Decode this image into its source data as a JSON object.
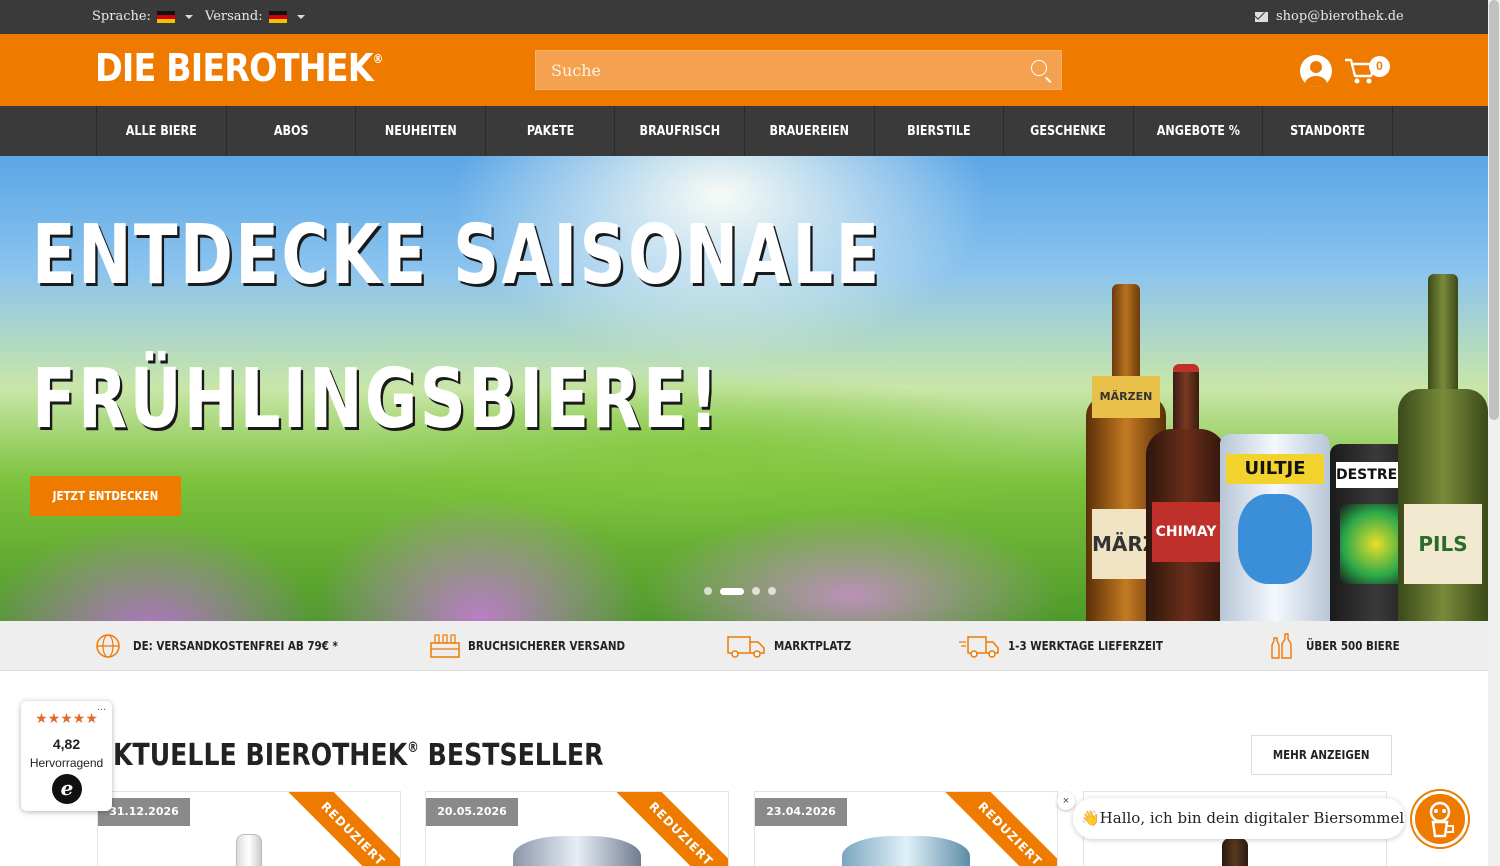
{
  "topbar": {
    "language_label": "Sprache:",
    "shipping_label": "Versand:",
    "email": "shop@bierothek.de"
  },
  "header": {
    "logo_text": "DIE BIEROTHEK",
    "logo_reg": "®",
    "search_placeholder": "Suche",
    "cart_count": "0"
  },
  "nav": {
    "items": [
      "ALLE BIERE",
      "ABOS",
      "NEUHEITEN",
      "PAKETE",
      "BRAUFRISCH",
      "BRAUEREIEN",
      "BIERSTILE",
      "GESCHENKE",
      "ANGEBOTE %",
      "STANDORTE"
    ]
  },
  "hero": {
    "line1": "ENTDECKE SAISONALE",
    "line2": "FRÜHLINGSBIERE!",
    "cta": "JETZT ENTDECKEN",
    "slides_total": 4,
    "active_slide": 2,
    "bottle_labels": [
      "MÄRZEN",
      "CHIMAY",
      "UILTJE",
      "DESTREEK",
      "PILS"
    ]
  },
  "usp": {
    "items": [
      "DE: VERSANDKOSTENFREI AB 79€ *",
      "BRUCHSICHERER VERSAND",
      "MARKTPLATZ",
      "1-3 WERKTAGE LIEFERZEIT",
      "ÜBER 500 BIERE"
    ]
  },
  "bestseller": {
    "title": "KTUELLE BIEROTHEK",
    "title_reg": "®",
    "title_end": "BESTSELLER",
    "more_button": "MEHR ANZEIGEN",
    "cards": [
      {
        "date": "31.12.2026",
        "ribbon": "REDUZIERT"
      },
      {
        "date": "20.05.2026",
        "ribbon": "REDUZIERT"
      },
      {
        "date": "23.04.2026",
        "ribbon": "REDUZIERT"
      },
      {
        "date": "",
        "ribbon": ""
      }
    ]
  },
  "trust": {
    "stars": "★★★★★",
    "score": "4,82",
    "verdict": "Hervorragend",
    "emblem": "e",
    "more": "..."
  },
  "chat": {
    "close": "×",
    "message": "👋Hallo, ich bin dein digitaler Biersommelier"
  },
  "colors": {
    "brand_orange": "#ee7a00",
    "dark_bar": "#3a3a3a"
  }
}
